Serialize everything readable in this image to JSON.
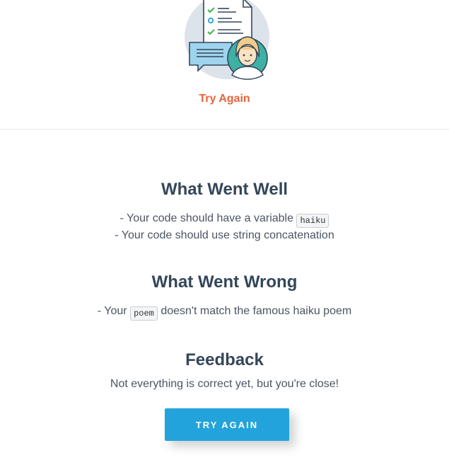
{
  "header": {
    "status_label": "Try Again",
    "illustration_icon": "quiz-result-person-icon"
  },
  "went_well": {
    "title": "What Went Well",
    "line1_prefix": "- Your code should have a variable",
    "line1_code": "haiku",
    "line2": "- Your code should use string concatenation"
  },
  "went_wrong": {
    "title": "What Went Wrong",
    "line1_prefix": "- Your",
    "line1_code": "poem",
    "line1_suffix": "doesn't match the famous haiku poem"
  },
  "feedback": {
    "title": "Feedback",
    "message": "Not everything is correct yet, but you're close!"
  },
  "actions": {
    "try_again_label": "TRY AGAIN"
  },
  "colors": {
    "accent_orange": "#e8643c",
    "button_blue": "#23a3db",
    "heading": "#34465a",
    "check_green": "#3bb54a"
  }
}
